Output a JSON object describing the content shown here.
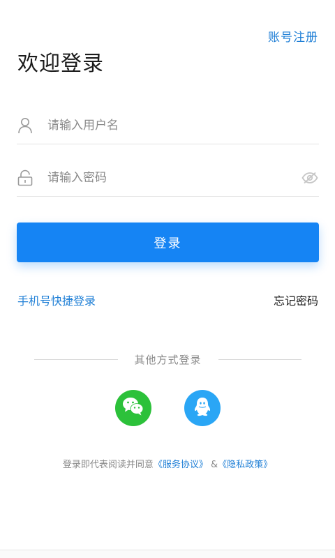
{
  "header": {
    "register_label": "账号注册",
    "title": "欢迎登录"
  },
  "form": {
    "username_placeholder": "请输入用户名",
    "username_value": "",
    "password_placeholder": "请输入密码",
    "password_value": "",
    "login_label": "登录"
  },
  "links": {
    "quick_login_label": "手机号快捷登录",
    "forgot_password_label": "忘记密码"
  },
  "other_login": {
    "divider_label": "其他方式登录",
    "options": [
      "wechat",
      "qq"
    ]
  },
  "agreement": {
    "prefix": "登录即代表阅读并同意",
    "service_link": "《服务协议》",
    "separator": "&",
    "privacy_link": "《隐私政策》"
  },
  "colors": {
    "accent": "#1584f4",
    "link": "#1f7fd6",
    "wechat": "#2cc13a",
    "qq": "#2aa6f5"
  },
  "icons": {
    "username": "user-icon",
    "password": "lock-icon",
    "visibility": "eye-off-icon",
    "wechat": "wechat-icon",
    "qq": "qq-icon"
  }
}
